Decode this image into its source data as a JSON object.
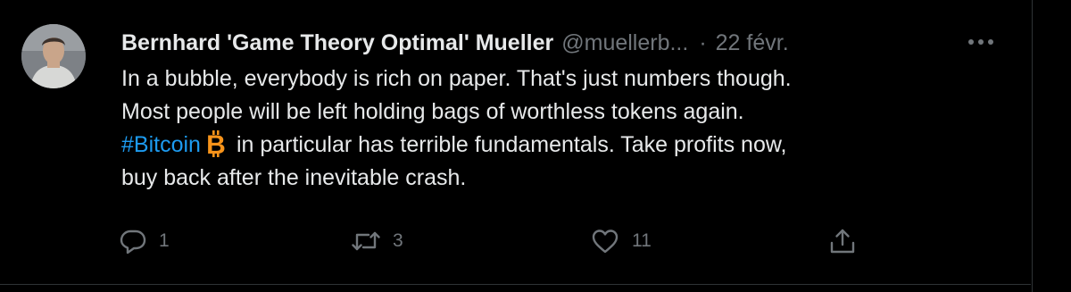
{
  "tweet": {
    "author": {
      "display_name": "Bernhard 'Game Theory Optimal' Mueller",
      "handle": "@muellerb...",
      "separator": "·",
      "date": "22 févr."
    },
    "more_label": "•••",
    "text": {
      "line1": "In a bubble, everybody is rich on paper. That's just numbers though.",
      "line2": "Most people will be left holding bags of worthless tokens again.",
      "hashtag": "#Bitcoin",
      "emoji_icon": "bitcoin-icon",
      "line3_rest": "in particular has terrible fundamentals. Take profits now,",
      "line4": "buy back after the inevitable crash."
    },
    "actions": {
      "reply_count": "1",
      "retweet_count": "3",
      "like_count": "11"
    }
  },
  "colors": {
    "background": "#000000",
    "text": "#e7e9ea",
    "secondary": "#71767b",
    "link": "#1d9bf0",
    "bitcoin": "#f7931a",
    "border": "#2f3336"
  }
}
